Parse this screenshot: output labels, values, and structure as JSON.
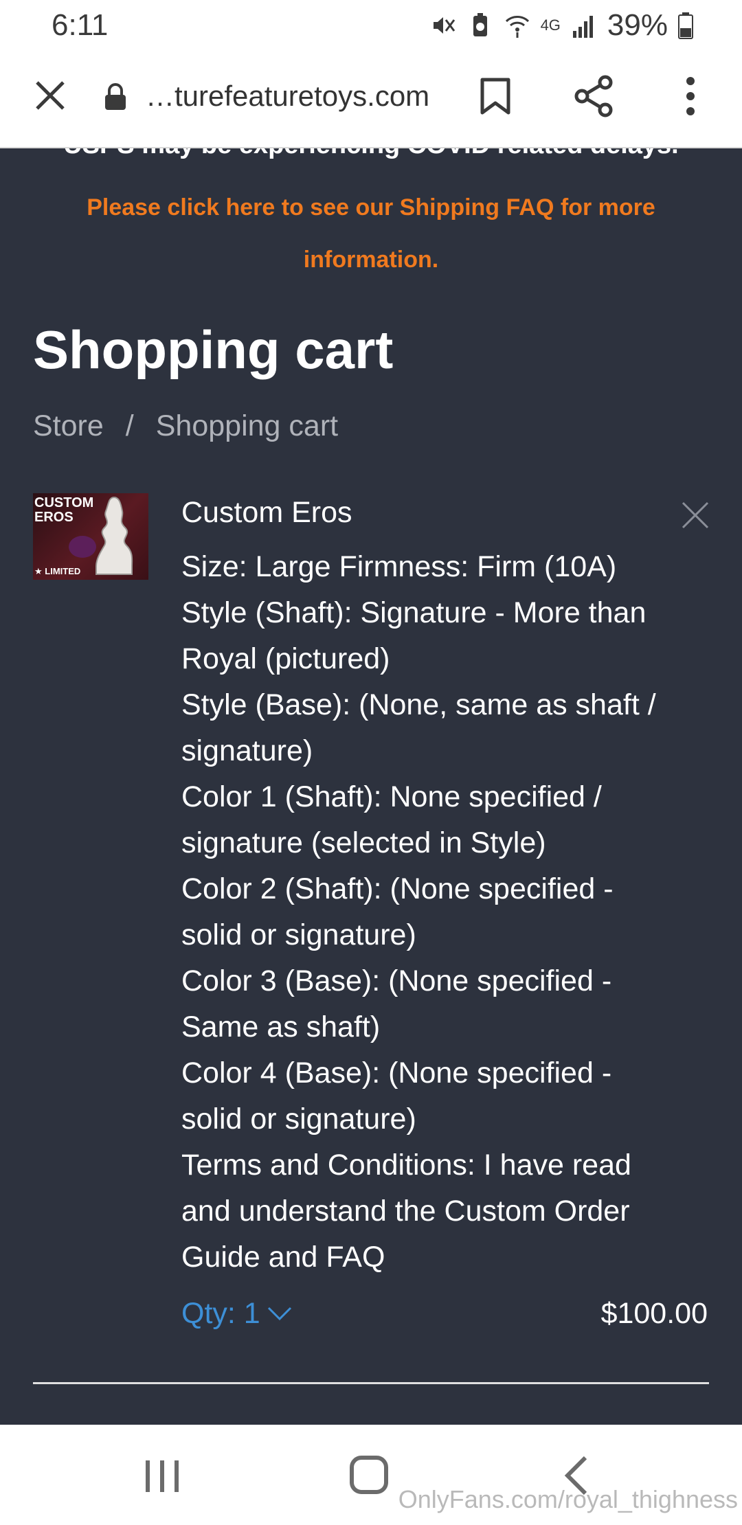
{
  "status_bar": {
    "time": "6:11",
    "network": "4G",
    "battery": "39%"
  },
  "browser": {
    "url": "…turefeaturetoys.com"
  },
  "banner": {
    "covid_line": "USPS may be experiencing COVID related delays.",
    "shipping_notice": "Please click here to see our Shipping FAQ for more information."
  },
  "page_title": "Shopping cart",
  "breadcrumb": {
    "store": "Store",
    "separator": "/",
    "current": "Shopping cart"
  },
  "cart_item": {
    "thumb_title": "CUSTOM EROS",
    "thumb_badge": "★ LIMITED",
    "name": "Custom Eros",
    "options": [
      "Size: Large  Firmness: Firm (10A)",
      "Style (Shaft): Signature - More than",
      "Royal (pictured)",
      "Style (Base): (None, same as shaft /",
      "signature)",
      "Color 1 (Shaft): None specified /",
      "signature (selected in Style)",
      "Color 2 (Shaft): (None specified -",
      "solid or signature)",
      "Color 3 (Base): (None specified -",
      "Same as shaft)",
      "Color 4 (Base): (None specified -",
      "solid or signature)",
      "Terms and Conditions: I have read",
      "and understand the Custom Order",
      "Guide and FAQ"
    ],
    "qty_label": "Qty: 1",
    "price": "$100.00"
  },
  "watermark": "OnlyFans.com/royal_thighness",
  "colors": {
    "page_bg": "#2d323e",
    "accent_orange": "#f07a1f",
    "link_blue": "#3d8fd6"
  }
}
